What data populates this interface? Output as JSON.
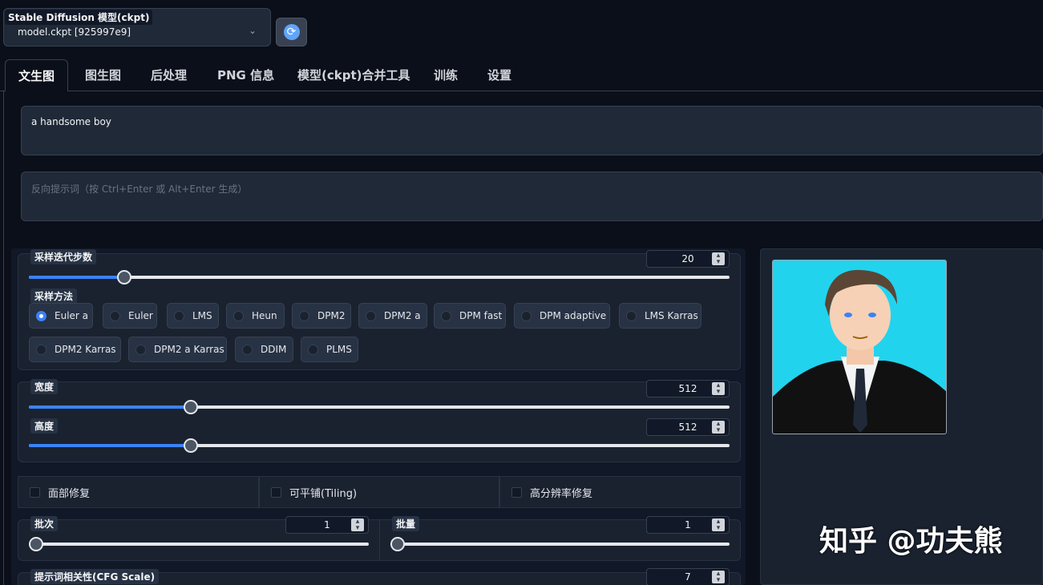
{
  "model": {
    "label": "Stable Diffusion 模型(ckpt)",
    "value": "model.ckpt [925997e9]"
  },
  "tabs": [
    {
      "label": "文生图"
    },
    {
      "label": "图生图"
    },
    {
      "label": "后处理"
    },
    {
      "label": "PNG 信息"
    },
    {
      "label": "模型(ckpt)合并工具"
    },
    {
      "label": "训练"
    },
    {
      "label": "设置"
    }
  ],
  "prompt": {
    "value": "a handsome boy",
    "negative_placeholder": "反向提示词（按 Ctrl+Enter 或 Alt+Enter 生成）"
  },
  "sampling_steps": {
    "label": "采样迭代步数",
    "value": "20",
    "fraction": 0.136
  },
  "sampling_method": {
    "label": "采样方法",
    "options": [
      "Euler a",
      "Euler",
      "LMS",
      "Heun",
      "DPM2",
      "DPM2 a",
      "DPM fast",
      "DPM adaptive",
      "LMS Karras",
      "DPM2 Karras",
      "DPM2 a Karras",
      "DDIM",
      "PLMS"
    ],
    "selected": "Euler a"
  },
  "width": {
    "label": "宽度",
    "value": "512",
    "fraction": 0.231
  },
  "height": {
    "label": "高度",
    "value": "512",
    "fraction": 0.231
  },
  "checkboxes": [
    "面部修复",
    "可平铺(Tiling)",
    "高分辨率修复"
  ],
  "batch_count": {
    "label": "批次",
    "value": "1"
  },
  "batch_size": {
    "label": "批量",
    "value": "1"
  },
  "cfg_scale": {
    "label": "提示词相关性(CFG Scale)",
    "value": "7"
  },
  "watermark": "知乎 @功夫熊",
  "colors": {
    "accent": "#3b82f6",
    "background": "#0b0f19",
    "panel": "#1f2937",
    "image_bg": "#22d3ee"
  },
  "icons": {
    "refresh": "refresh-icon",
    "chevron": "chevron-down-icon"
  }
}
